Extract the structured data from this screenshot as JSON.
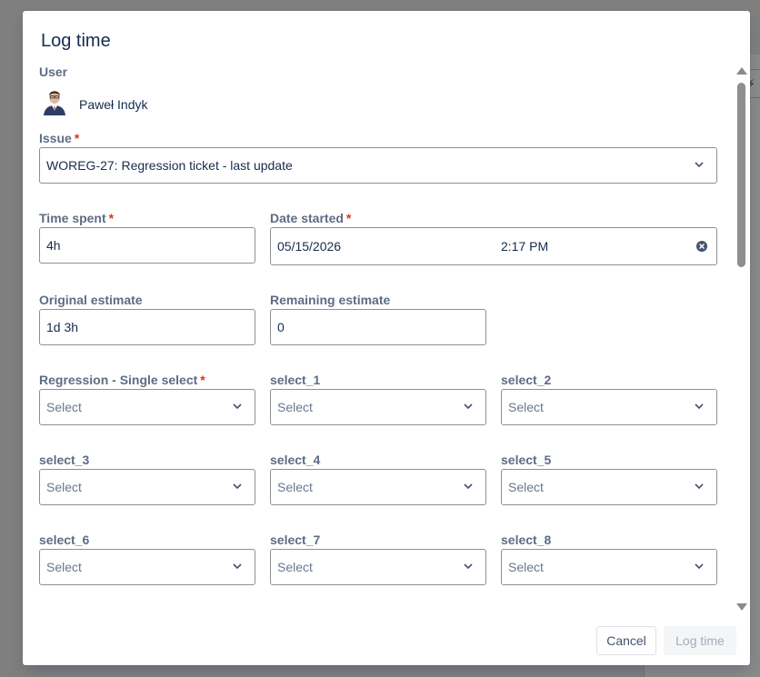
{
  "modal": {
    "title": "Log time",
    "user": {
      "label": "User",
      "name": "Paweł Indyk"
    },
    "issue": {
      "label": "Issue",
      "required_mark": "*",
      "value": "WOREG-27: Regression ticket - last update"
    },
    "time_spent": {
      "label": "Time spent",
      "required_mark": "*",
      "value": "4h"
    },
    "date_started": {
      "label": "Date started",
      "required_mark": "*",
      "date": "05/15/2026",
      "time": "2:17 PM"
    },
    "original_estimate": {
      "label": "Original estimate",
      "value": "1d 3h"
    },
    "remaining_estimate": {
      "label": "Remaining estimate",
      "value": "0"
    },
    "selects": [
      {
        "label": "Regression - Single select",
        "required_mark": "*",
        "value": "Select"
      },
      {
        "label": "select_1",
        "value": "Select"
      },
      {
        "label": "select_2",
        "value": "Select"
      },
      {
        "label": "select_3",
        "value": "Select"
      },
      {
        "label": "select_4",
        "value": "Select"
      },
      {
        "label": "select_5",
        "value": "Select"
      },
      {
        "label": "select_6",
        "value": "Select"
      },
      {
        "label": "select_7",
        "value": "Select"
      },
      {
        "label": "select_8",
        "value": "Select"
      }
    ],
    "buttons": {
      "cancel": "Cancel",
      "log_time": "Log time"
    }
  },
  "icons": {
    "chevron": "chevron-down-icon",
    "clear": "clear-icon",
    "avatar": "user-avatar"
  },
  "colors": {
    "required": "#de350b",
    "label": "#5e6c84",
    "text": "#172b4d",
    "border": "#8c9097",
    "disabled_text": "#a5adba"
  }
}
